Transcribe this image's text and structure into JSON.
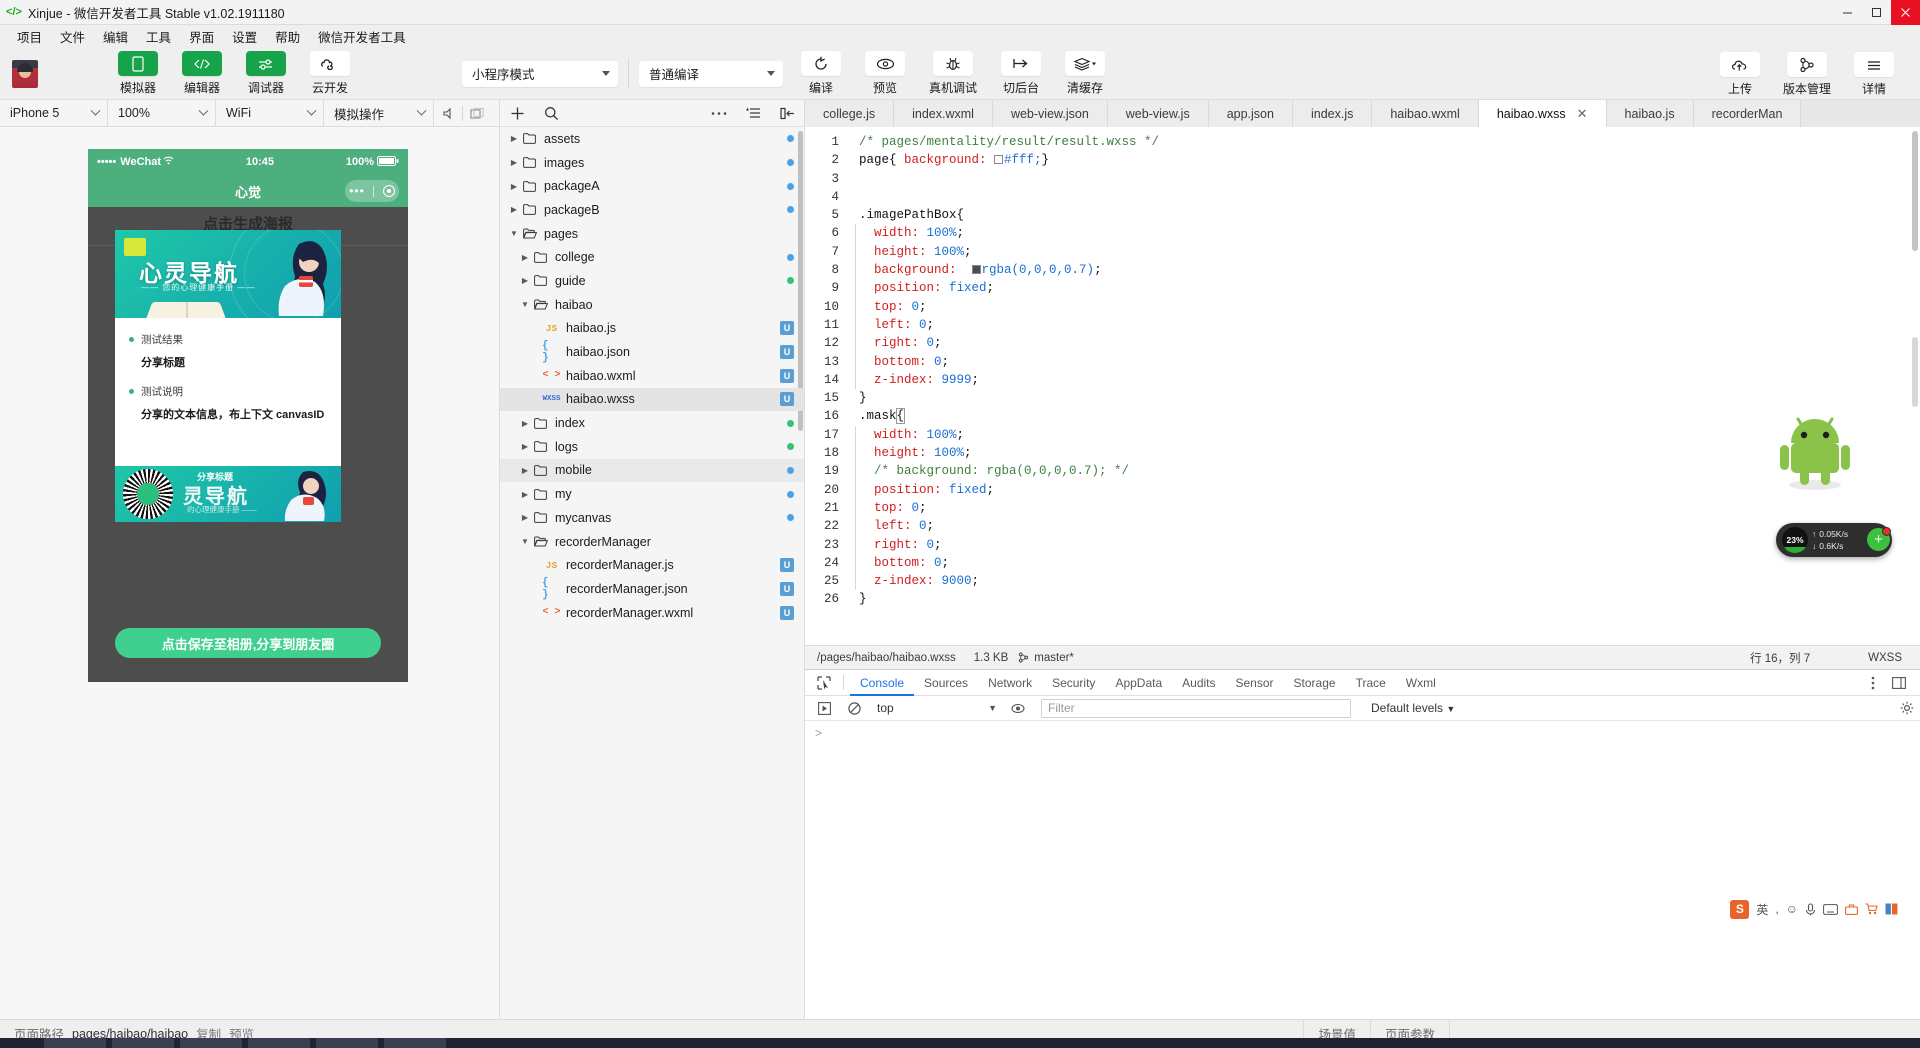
{
  "window": {
    "title": "Xinjue - 微信开发者工具 Stable v1.02.1911180",
    "logo_icon": "code-brackets-icon",
    "minimize": "−",
    "maximize": "▢",
    "close": "✕"
  },
  "menubar": {
    "items": [
      "项目",
      "文件",
      "编辑",
      "工具",
      "界面",
      "设置",
      "帮助",
      "微信开发者工具"
    ]
  },
  "toolbar": {
    "avatar_name": "user-avatar",
    "left_buttons": [
      {
        "label": "模拟器",
        "icon": "phone-icon",
        "active": true
      },
      {
        "label": "编辑器",
        "icon": "code-icon",
        "active": true
      },
      {
        "label": "调试器",
        "icon": "sliders-icon",
        "active": true
      },
      {
        "label": "云开发",
        "icon": "cloud-dev-icon",
        "active": false
      }
    ],
    "mode_select": "小程序模式",
    "compile_select": "普通编译",
    "mid_buttons": [
      {
        "label": "编译",
        "icon": "refresh-icon"
      },
      {
        "label": "预览",
        "icon": "eye-icon"
      },
      {
        "label": "真机调试",
        "icon": "bug-icon"
      },
      {
        "label": "切后台",
        "icon": "background-icon"
      },
      {
        "label": "清缓存",
        "icon": "layers-icon",
        "has_caret": true
      }
    ],
    "right_buttons": [
      {
        "label": "上传",
        "icon": "cloud-upload-icon"
      },
      {
        "label": "版本管理",
        "icon": "git-branch-icon"
      },
      {
        "label": "详情",
        "icon": "hamburger-icon"
      }
    ]
  },
  "simulator": {
    "device": "iPhone 5",
    "zoom": "100%",
    "network": "WiFi",
    "actions": "模拟操作",
    "icons": [
      "volume-icon",
      "rotate-screen-icon"
    ],
    "phone": {
      "carrier": "WeChat",
      "signal_dots": "•••••",
      "wifi_icon": "wifi-icon",
      "time": "10:45",
      "battery_pct": "100%",
      "nav_title": "心觉",
      "capsule_dots": "•••",
      "ghost_title": "点击生成海报",
      "poster": {
        "hero_title": "心灵导航",
        "hero_sub": "—— 您的心理健康手册 ——",
        "rows": [
          {
            "label": "测试结果",
            "value": "分享标题"
          },
          {
            "label": "测试说明",
            "value": "分享的文本信息，布上下文 canvasID"
          }
        ],
        "footer_small": "分享标题",
        "footer_title": "灵导航",
        "footer_sub": "的心理健康手册 ——"
      },
      "save_button": "点击保存至相册,分享到朋友圈"
    }
  },
  "filetree": {
    "toolbar_icons": [
      "add-icon",
      "search-icon",
      "more-icon",
      "sort-icon",
      "collapse-icon"
    ],
    "items": [
      {
        "name": "assets",
        "type": "folder",
        "depth": 0,
        "open": false,
        "dot": "#4aa3e8"
      },
      {
        "name": "images",
        "type": "folder",
        "depth": 0,
        "open": false,
        "dot": "#4aa3e8"
      },
      {
        "name": "packageA",
        "type": "folder",
        "depth": 0,
        "open": false,
        "dot": "#4aa3e8"
      },
      {
        "name": "packageB",
        "type": "folder",
        "depth": 0,
        "open": false,
        "dot": "#4aa3e8"
      },
      {
        "name": "pages",
        "type": "folder",
        "depth": 0,
        "open": true,
        "dot": ""
      },
      {
        "name": "college",
        "type": "folder",
        "depth": 1,
        "open": false,
        "dot": "#4aa3e8"
      },
      {
        "name": "guide",
        "type": "folder",
        "depth": 1,
        "open": false,
        "dot": "#36c26e"
      },
      {
        "name": "haibao",
        "type": "folder",
        "depth": 1,
        "open": true,
        "dot": ""
      },
      {
        "name": "haibao.js",
        "type": "js",
        "depth": 2,
        "badge": "U"
      },
      {
        "name": "haibao.json",
        "type": "json",
        "depth": 2,
        "badge": "U"
      },
      {
        "name": "haibao.wxml",
        "type": "wxml",
        "depth": 2,
        "badge": "U"
      },
      {
        "name": "haibao.wxss",
        "type": "wxss",
        "depth": 2,
        "badge": "U",
        "selected": true
      },
      {
        "name": "index",
        "type": "folder",
        "depth": 1,
        "open": false,
        "dot": "#36c26e"
      },
      {
        "name": "logs",
        "type": "folder",
        "depth": 1,
        "open": false,
        "dot": "#36c26e"
      },
      {
        "name": "mobile",
        "type": "folder",
        "depth": 1,
        "open": false,
        "dot": "#4aa3e8",
        "hover": true
      },
      {
        "name": "my",
        "type": "folder",
        "depth": 1,
        "open": false,
        "dot": "#4aa3e8"
      },
      {
        "name": "mycanvas",
        "type": "folder",
        "depth": 1,
        "open": false,
        "dot": "#4aa3e8"
      },
      {
        "name": "recorderManager",
        "type": "folder",
        "depth": 1,
        "open": true,
        "dot": ""
      },
      {
        "name": "recorderManager.js",
        "type": "js",
        "depth": 2,
        "badge": "U"
      },
      {
        "name": "recorderManager.json",
        "type": "json",
        "depth": 2,
        "badge": "U"
      },
      {
        "name": "recorderManager.wxml",
        "type": "wxml",
        "depth": 2,
        "badge": "U"
      }
    ]
  },
  "editor": {
    "tabs": [
      {
        "label": "college.js",
        "active": false
      },
      {
        "label": "index.wxml",
        "active": false
      },
      {
        "label": "web-view.json",
        "active": false
      },
      {
        "label": "web-view.js",
        "active": false
      },
      {
        "label": "app.json",
        "active": false
      },
      {
        "label": "index.js",
        "active": false
      },
      {
        "label": "haibao.wxml",
        "active": false
      },
      {
        "label": "haibao.wxss",
        "active": true,
        "closable": true
      },
      {
        "label": "haibao.js",
        "active": false
      },
      {
        "label": "recorderMan",
        "active": false
      }
    ],
    "code_lines": [
      {
        "n": 1,
        "indent": false,
        "parts": [
          {
            "t": "/* pages/mentality/result/result.wxss */",
            "c": "cm"
          }
        ]
      },
      {
        "n": 2,
        "indent": false,
        "parts": [
          {
            "t": "page{ ",
            "c": "sel"
          },
          {
            "t": "background: ",
            "c": "prop"
          },
          {
            "t": "__SWATCH_WHITE__",
            "c": "swatch"
          },
          {
            "t": "#fff;",
            "c": "val"
          },
          {
            "t": "}",
            "c": "punc"
          }
        ]
      },
      {
        "n": 3,
        "indent": false,
        "parts": []
      },
      {
        "n": 4,
        "indent": false,
        "parts": []
      },
      {
        "n": 5,
        "indent": false,
        "parts": [
          {
            "t": ".imagePathBox{",
            "c": "sel"
          }
        ]
      },
      {
        "n": 6,
        "indent": true,
        "parts": [
          {
            "t": "  width: ",
            "c": "prop"
          },
          {
            "t": "100%",
            "c": "val"
          },
          {
            "t": ";",
            "c": "punc"
          }
        ]
      },
      {
        "n": 7,
        "indent": true,
        "parts": [
          {
            "t": "  height: ",
            "c": "prop"
          },
          {
            "t": "100%",
            "c": "val"
          },
          {
            "t": ";",
            "c": "punc"
          }
        ]
      },
      {
        "n": 8,
        "indent": true,
        "parts": [
          {
            "t": "  background:  ",
            "c": "prop"
          },
          {
            "t": "__SWATCH_DARK__",
            "c": "swatch"
          },
          {
            "t": "rgba(0,0,0,0.7)",
            "c": "val"
          },
          {
            "t": ";",
            "c": "punc"
          }
        ]
      },
      {
        "n": 9,
        "indent": true,
        "parts": [
          {
            "t": "  position: ",
            "c": "prop"
          },
          {
            "t": "fixed",
            "c": "val"
          },
          {
            "t": ";",
            "c": "punc"
          }
        ]
      },
      {
        "n": 10,
        "indent": true,
        "parts": [
          {
            "t": "  top: ",
            "c": "prop"
          },
          {
            "t": "0",
            "c": "val"
          },
          {
            "t": ";",
            "c": "punc"
          }
        ]
      },
      {
        "n": 11,
        "indent": true,
        "parts": [
          {
            "t": "  left: ",
            "c": "prop"
          },
          {
            "t": "0",
            "c": "val"
          },
          {
            "t": ";",
            "c": "punc"
          }
        ]
      },
      {
        "n": 12,
        "indent": true,
        "parts": [
          {
            "t": "  right: ",
            "c": "prop"
          },
          {
            "t": "0",
            "c": "val"
          },
          {
            "t": ";",
            "c": "punc"
          }
        ]
      },
      {
        "n": 13,
        "indent": true,
        "parts": [
          {
            "t": "  bottom: ",
            "c": "prop"
          },
          {
            "t": "0",
            "c": "val"
          },
          {
            "t": ";",
            "c": "punc"
          }
        ]
      },
      {
        "n": 14,
        "indent": true,
        "parts": [
          {
            "t": "  z-index: ",
            "c": "prop"
          },
          {
            "t": "9999",
            "c": "val"
          },
          {
            "t": ";",
            "c": "punc"
          }
        ]
      },
      {
        "n": 15,
        "indent": false,
        "parts": [
          {
            "t": "}",
            "c": "punc"
          }
        ]
      },
      {
        "n": 16,
        "indent": false,
        "parts": [
          {
            "t": ".mask",
            "c": "sel"
          },
          {
            "t": "{",
            "c": "cursor"
          }
        ]
      },
      {
        "n": 17,
        "indent": true,
        "parts": [
          {
            "t": "  width: ",
            "c": "prop"
          },
          {
            "t": "100%",
            "c": "val"
          },
          {
            "t": ";",
            "c": "punc"
          }
        ]
      },
      {
        "n": 18,
        "indent": true,
        "parts": [
          {
            "t": "  height: ",
            "c": "prop"
          },
          {
            "t": "100%",
            "c": "val"
          },
          {
            "t": ";",
            "c": "punc"
          }
        ]
      },
      {
        "n": 19,
        "indent": true,
        "parts": [
          {
            "t": "  /* background: rgba(0,0,0,0.7); */",
            "c": "cm"
          }
        ]
      },
      {
        "n": 20,
        "indent": true,
        "parts": [
          {
            "t": "  position: ",
            "c": "prop"
          },
          {
            "t": "fixed",
            "c": "val"
          },
          {
            "t": ";",
            "c": "punc"
          }
        ]
      },
      {
        "n": 21,
        "indent": true,
        "parts": [
          {
            "t": "  top: ",
            "c": "prop"
          },
          {
            "t": "0",
            "c": "val"
          },
          {
            "t": ";",
            "c": "punc"
          }
        ]
      },
      {
        "n": 22,
        "indent": true,
        "parts": [
          {
            "t": "  left: ",
            "c": "prop"
          },
          {
            "t": "0",
            "c": "val"
          },
          {
            "t": ";",
            "c": "punc"
          }
        ]
      },
      {
        "n": 23,
        "indent": true,
        "parts": [
          {
            "t": "  right: ",
            "c": "prop"
          },
          {
            "t": "0",
            "c": "val"
          },
          {
            "t": ";",
            "c": "punc"
          }
        ]
      },
      {
        "n": 24,
        "indent": true,
        "parts": [
          {
            "t": "  bottom: ",
            "c": "prop"
          },
          {
            "t": "0",
            "c": "val"
          },
          {
            "t": ";",
            "c": "punc"
          }
        ]
      },
      {
        "n": 25,
        "indent": true,
        "parts": [
          {
            "t": "  z-index: ",
            "c": "prop"
          },
          {
            "t": "9000",
            "c": "val"
          },
          {
            "t": ";",
            "c": "punc"
          }
        ]
      },
      {
        "n": 26,
        "indent": false,
        "parts": [
          {
            "t": "}",
            "c": "punc"
          }
        ]
      }
    ],
    "statusbar": {
      "path": "/pages/haibao/haibao.wxss",
      "size": "1.3 KB",
      "branch_icon": "git-branch-icon",
      "branch": "master*",
      "cursor": "行 16，列 7",
      "language": "WXSS"
    }
  },
  "devtools": {
    "inspect_icon": "inspect-cursor-icon",
    "tabs": [
      "Console",
      "Sources",
      "Network",
      "Security",
      "AppData",
      "Audits",
      "Sensor",
      "Storage",
      "Trace",
      "Wxml"
    ],
    "active_tab": "Console",
    "right_icons": [
      "kebab-menu-icon",
      "dock-icon"
    ],
    "filterbar": {
      "execute_icon": "execute-icon",
      "clear_icon": "clear-console-icon",
      "context": "top",
      "eye_icon": "eye-icon",
      "filter_placeholder": "Filter",
      "levels": "Default levels",
      "settings_icon": "gear-icon"
    },
    "prompt": ">"
  },
  "bottom_status": {
    "page_path_label": "页面路径",
    "page_path": "pages/haibao/haibao",
    "copy": "复制",
    "preview": "预览",
    "scene_value": "场景值",
    "page_params": "页面参数"
  },
  "overlay": {
    "mascot_name": "android-mascot",
    "net_widget": {
      "cpu_pct": "23%",
      "up_icon": "arrow-up-icon",
      "up_rate": "0.05K/s",
      "down_icon": "arrow-down-icon",
      "down_rate": "0.6K/s",
      "plus_icon": "plus-icon"
    },
    "ime": {
      "logo": "S",
      "mode": "英",
      "icons": [
        "punctuation-icon",
        "smiley-icon",
        "mic-icon",
        "keyboard-icon",
        "toolbox-icon",
        "cart-icon",
        "panel-icon"
      ]
    }
  },
  "colors": {
    "accent_green": "#16a34a",
    "wechat_green": "#4caf7d",
    "devtools_blue": "#1a73e8",
    "badge_blue": "#5a9fd4",
    "close_red": "#e81123"
  }
}
